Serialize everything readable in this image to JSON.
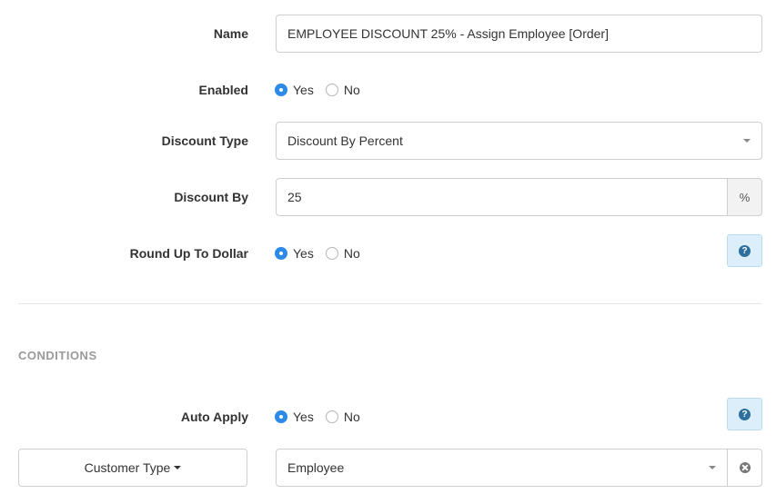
{
  "form": {
    "name": {
      "label": "Name",
      "value": "EMPLOYEE DISCOUNT 25% - Assign Employee [Order]"
    },
    "enabled": {
      "label": "Enabled",
      "options": [
        "Yes",
        "No"
      ],
      "selected": "Yes"
    },
    "discount_type": {
      "label": "Discount Type",
      "value": "Discount By Percent"
    },
    "discount_by": {
      "label": "Discount By",
      "value": "25",
      "addon": "%"
    },
    "round_up": {
      "label": "Round Up To Dollar",
      "options": [
        "Yes",
        "No"
      ],
      "selected": "Yes",
      "help": "?"
    }
  },
  "conditions": {
    "title": "CONDITIONS",
    "auto_apply": {
      "label": "Auto Apply",
      "options": [
        "Yes",
        "No"
      ],
      "selected": "Yes",
      "help": "?"
    },
    "filter": {
      "button_label": "Customer Type",
      "value": "Employee"
    }
  },
  "colors": {
    "accent": "#2d8ae8",
    "help_bg": "#dbeefa",
    "help_icon": "#2e6f9e",
    "section_title": "#9a9a9a"
  },
  "icons": {
    "help": "question-circle-icon",
    "clear": "times-circle-icon",
    "caret": "caret-down-icon"
  }
}
